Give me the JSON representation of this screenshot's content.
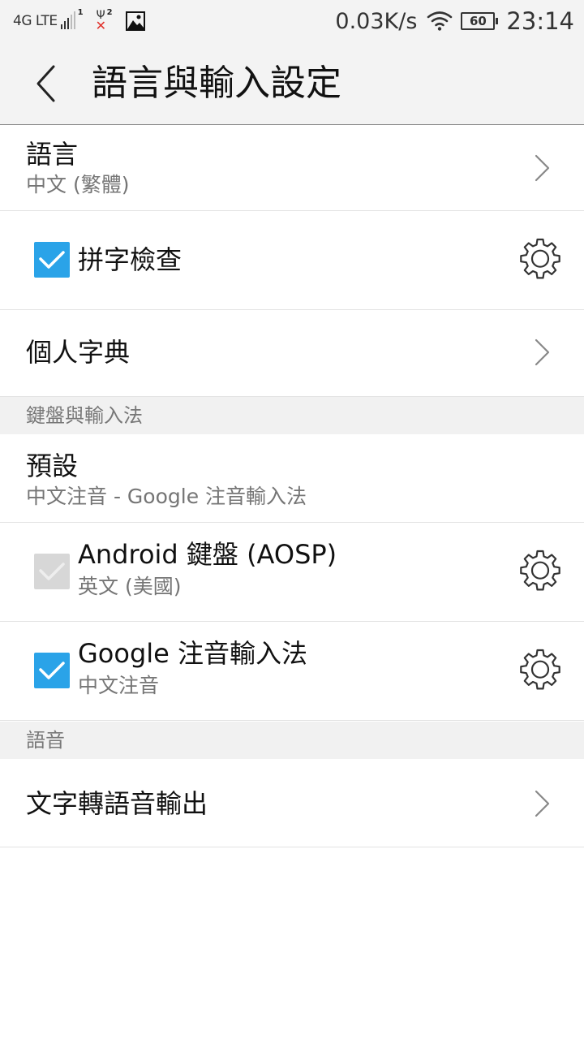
{
  "status_bar": {
    "network": "4G LTE",
    "sim1_label": "1",
    "sim2_label": "2",
    "speed": "0.03K/s",
    "battery": "60",
    "time": "23:14"
  },
  "header": {
    "title": "語言與輸入設定"
  },
  "items": {
    "language": {
      "title": "語言",
      "subtitle": "中文 (繁體)"
    },
    "spell_check": {
      "title": "拼字檢查",
      "checked": true
    },
    "personal_dictionary": {
      "title": "個人字典"
    }
  },
  "sections": {
    "keyboard": "鍵盤與輸入法",
    "voice": "語音"
  },
  "keyboard": {
    "default": {
      "title": "預設",
      "subtitle": "中文注音 - Google 注音輸入法"
    },
    "aosp": {
      "title": "Android 鍵盤 (AOSP)",
      "subtitle": "英文 (美國)",
      "checked": true,
      "enabled": false
    },
    "google_zhuyin": {
      "title": "Google 注音輸入法",
      "subtitle": "中文注音",
      "checked": true
    }
  },
  "voice": {
    "tts": {
      "title": "文字轉語音輸出"
    }
  },
  "colors": {
    "accent": "#2aa3e8",
    "disabled_checkbox": "#d7d7d7",
    "section_bg": "#f1f1f1"
  },
  "icons": {
    "back": "chevron-left-icon",
    "chevron": "chevron-right-icon",
    "settings": "gear-icon",
    "check": "checkmark-icon"
  }
}
